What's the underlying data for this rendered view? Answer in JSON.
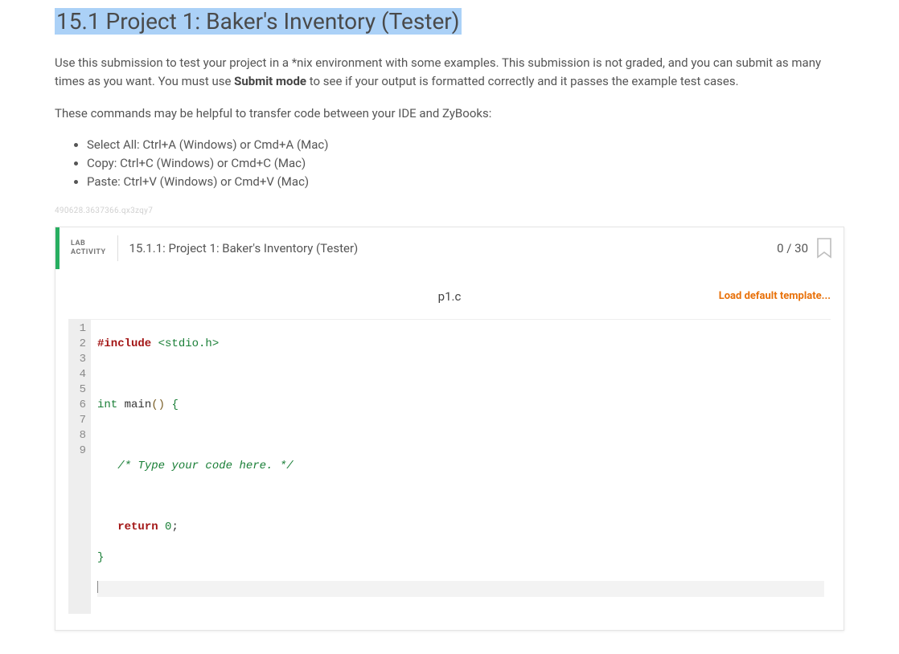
{
  "heading": "15.1 Project 1: Baker's Inventory (Tester)",
  "intro_p1_before": "Use this submission to test your project in a *nix environment with some examples. This submission is not graded, and you can submit as many times as you want. You must use ",
  "intro_p1_bold": "Submit mode",
  "intro_p1_after": " to see if your output is formatted correctly and it passes the example test cases.",
  "intro_p2": "These commands may be helpful to transfer code between your IDE and ZyBooks:",
  "shortcuts": [
    "Select All: Ctrl+A (Windows) or Cmd+A (Mac)",
    "Copy: Ctrl+C (Windows) or Cmd+C (Mac)",
    "Paste: Ctrl+V (Windows) or Cmd+V (Mac)"
  ],
  "meta_id": "490628.3637366.qx3zqy7",
  "lab": {
    "badge_line1": "LAB",
    "badge_line2": "ACTIVITY",
    "title": "15.1.1: Project 1: Baker's Inventory (Tester)",
    "score": "0 / 30",
    "file_name": "p1.c",
    "load_template": "Load default template..."
  },
  "code": {
    "l1_include": "#include",
    "l1_hdr": "<stdio.h>",
    "l3_ty": "int",
    "l3_fn": "main",
    "l3_paren": "()",
    "l3_open": "{",
    "l5_cm": "/* Type your code here. */",
    "l7_rt": "return",
    "l7_num": "0",
    "l8_close": "}",
    "nums": {
      "n1": "1",
      "n2": "2",
      "n3": "3",
      "n4": "4",
      "n5": "5",
      "n6": "6",
      "n7": "7",
      "n8": "8",
      "n9": "9"
    }
  }
}
